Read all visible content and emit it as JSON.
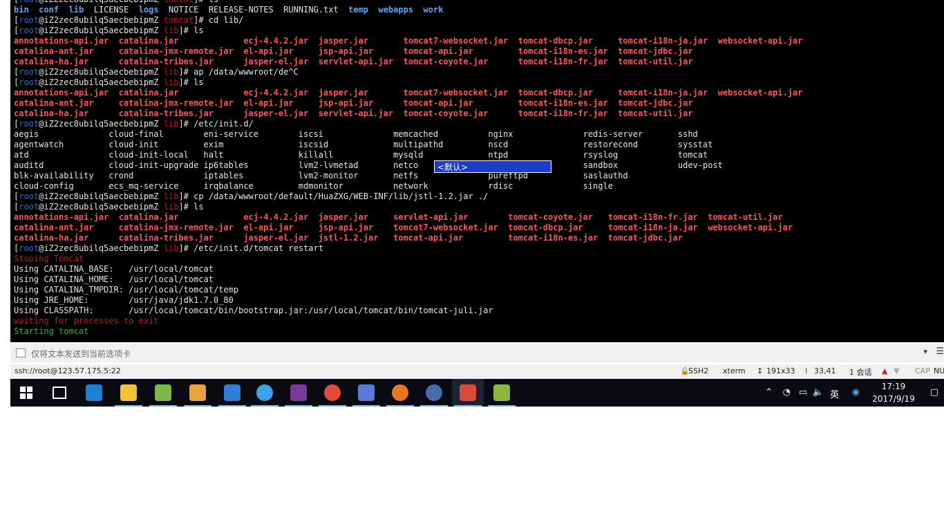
{
  "terminal": {
    "lines": [
      [
        {
          "t": "[",
          "c": ""
        },
        {
          "t": "root",
          "c": "host"
        },
        {
          "t": "@iZ2zec8ubilq5aecbebipmZ ",
          "c": ""
        },
        {
          "t": "tomcat",
          "c": "path"
        },
        {
          "t": "]# ls",
          "c": ""
        }
      ],
      [
        {
          "t": "bin",
          "c": "blue"
        },
        {
          "t": "  ",
          "c": ""
        },
        {
          "t": "conf",
          "c": "blue"
        },
        {
          "t": "  ",
          "c": ""
        },
        {
          "t": "lib",
          "c": "blue"
        },
        {
          "t": "  LICENSE  ",
          "c": ""
        },
        {
          "t": "logs",
          "c": "blue"
        },
        {
          "t": "  NOTICE  RELEASE-NOTES  RUNNING.txt  ",
          "c": ""
        },
        {
          "t": "temp",
          "c": "blue"
        },
        {
          "t": "  ",
          "c": ""
        },
        {
          "t": "webapps",
          "c": "blue"
        },
        {
          "t": "  ",
          "c": ""
        },
        {
          "t": "work",
          "c": "blue"
        }
      ],
      [
        {
          "t": "[",
          "c": ""
        },
        {
          "t": "root",
          "c": "host"
        },
        {
          "t": "@iZ2zec8ubilq5aecbebipmZ ",
          "c": ""
        },
        {
          "t": "tomcat",
          "c": "path"
        },
        {
          "t": "]# cd lib/",
          "c": ""
        }
      ],
      [
        {
          "t": "[",
          "c": ""
        },
        {
          "t": "root",
          "c": "host"
        },
        {
          "t": "@iZ2zec8ubilq5aecbebipmZ ",
          "c": ""
        },
        {
          "t": "lib",
          "c": "path"
        },
        {
          "t": "]# ls",
          "c": ""
        }
      ],
      [
        {
          "t": "annotations-api.jar  catalina.jar             ecj-4.4.2.jar  jasper.jar       tomcat7-websocket.jar  tomcat-dbcp.jar     tomcat-i18n-ja.jar  websocket-api.jar",
          "c": "red"
        }
      ],
      [
        {
          "t": "catalina-ant.jar     catalina-jmx-remote.jar  el-api.jar     jsp-api.jar      tomcat-api.jar         tomcat-i18n-es.jar  tomcat-jdbc.jar",
          "c": "red"
        }
      ],
      [
        {
          "t": "catalina-ha.jar      catalina-tribes.jar      jasper-el.jar  servlet-api.jar  tomcat-coyote.jar      tomcat-i18n-fr.jar  tomcat-util.jar",
          "c": "red"
        }
      ],
      [
        {
          "t": "[",
          "c": ""
        },
        {
          "t": "root",
          "c": "host"
        },
        {
          "t": "@iZ2zec8ubilq5aecbebipmZ ",
          "c": ""
        },
        {
          "t": "lib",
          "c": "path"
        },
        {
          "t": "]# ap /data/wwwroot/de^C",
          "c": ""
        }
      ],
      [
        {
          "t": "[",
          "c": ""
        },
        {
          "t": "root",
          "c": "host"
        },
        {
          "t": "@iZ2zec8ubilq5aecbebipmZ ",
          "c": ""
        },
        {
          "t": "lib",
          "c": "path"
        },
        {
          "t": "]# ls",
          "c": ""
        }
      ],
      [
        {
          "t": "annotations-api.jar  catalina.jar             ecj-4.4.2.jar  jasper.jar       tomcat7-websocket.jar  tomcat-dbcp.jar     tomcat-i18n-ja.jar  websocket-api.jar",
          "c": "red"
        }
      ],
      [
        {
          "t": "catalina-ant.jar     catalina-jmx-remote.jar  el-api.jar     jsp-api.jar      tomcat-api.jar         tomcat-i18n-es.jar  tomcat-jdbc.jar",
          "c": "red"
        }
      ],
      [
        {
          "t": "catalina-ha.jar      catalina-tribes.jar      jasper-el.jar  servlet-api.jar  tomcat-coyote.jar      tomcat-i18n-fr.jar  tomcat-util.jar",
          "c": "red"
        }
      ],
      [
        {
          "t": "[",
          "c": ""
        },
        {
          "t": "root",
          "c": "host"
        },
        {
          "t": "@iZ2zec8ubilq5aecbebipmZ ",
          "c": ""
        },
        {
          "t": "lib",
          "c": "path"
        },
        {
          "t": "]# /etc/init.d/",
          "c": ""
        }
      ],
      [
        {
          "t": "aegis              cloud-final        eni-service        iscsi              memcached          nginx              redis-server       sshd",
          "c": ""
        }
      ],
      [
        {
          "t": "agentwatch         cloud-init         exim               iscsid             multipathd         nscd               restorecond        sysstat",
          "c": ""
        }
      ],
      [
        {
          "t": "atd                cloud-init-local   halt               killall            mysqld             ntpd               rsyslog            tomcat",
          "c": ""
        }
      ],
      [
        {
          "t": "auditd             cloud-init-upgrade ip6tables          lvm2-lvmetad       netco                                 sandbox            udev-post",
          "c": ""
        }
      ],
      [
        {
          "t": "blk-availability   crond              iptables           lvm2-monitor       netfs              pureftpd           saslauthd",
          "c": ""
        }
      ],
      [
        {
          "t": "cloud-config       ecs_mq-service     irqbalance         mdmonitor          network            rdisc              single",
          "c": ""
        }
      ],
      [
        {
          "t": "[",
          "c": ""
        },
        {
          "t": "root",
          "c": "host"
        },
        {
          "t": "@iZ2zec8ubilq5aecbebipmZ ",
          "c": ""
        },
        {
          "t": "lib",
          "c": "path"
        },
        {
          "t": "]# cp /data/wwwroot/default/HuaZXG/WEB-INF/lib/jstl-1.2.jar ./",
          "c": ""
        }
      ],
      [
        {
          "t": "[",
          "c": ""
        },
        {
          "t": "root",
          "c": "host"
        },
        {
          "t": "@iZ2zec8ubilq5aecbebipmZ ",
          "c": ""
        },
        {
          "t": "lib",
          "c": "path"
        },
        {
          "t": "]# ls",
          "c": ""
        }
      ],
      [
        {
          "t": "annotations-api.jar  catalina.jar             ecj-4.4.2.jar  jasper.jar     servlet-api.jar        tomcat-coyote.jar   tomcat-i18n-fr.jar  tomcat-util.jar",
          "c": "red"
        }
      ],
      [
        {
          "t": "catalina-ant.jar     catalina-jmx-remote.jar  el-api.jar     jsp-api.jar    tomcat7-websocket.jar  tomcat-dbcp.jar     tomcat-i18n-ja.jar  websocket-api.jar",
          "c": "red"
        }
      ],
      [
        {
          "t": "catalina-ha.jar      catalina-tribes.jar      jasper-el.jar  jstl-1.2.jar   tomcat-api.jar         tomcat-i18n-es.jar  tomcat-jdbc.jar",
          "c": "red"
        }
      ],
      [
        {
          "t": "[",
          "c": ""
        },
        {
          "t": "root",
          "c": "host"
        },
        {
          "t": "@iZ2zec8ubilq5aecbebipmZ ",
          "c": ""
        },
        {
          "t": "lib",
          "c": "path"
        },
        {
          "t": "]# /etc/init.d/tomcat restart",
          "c": ""
        }
      ],
      [
        {
          "t": "Stoping Tomcat",
          "c": "dred"
        }
      ],
      [
        {
          "t": "Using CATALINA_BASE:   /usr/local/tomcat",
          "c": ""
        }
      ],
      [
        {
          "t": "Using CATALINA_HOME:   /usr/local/tomcat",
          "c": ""
        }
      ],
      [
        {
          "t": "Using CATALINA_TMPDIR: /usr/local/tomcat/temp",
          "c": ""
        }
      ],
      [
        {
          "t": "Using JRE_HOME:        /usr/java/jdk1.7.0_80",
          "c": ""
        }
      ],
      [
        {
          "t": "Using CLASSPATH:       /usr/local/tomcat/bin/bootstrap.jar:/usr/local/tomcat/bin/tomcat-juli.jar",
          "c": ""
        }
      ],
      [
        {
          "t": "waiting for processes to exit",
          "c": "dred"
        }
      ],
      [
        {
          "t": "Starting tomcat",
          "c": "green"
        }
      ]
    ]
  },
  "ime_popup": {
    "label": "<默认>"
  },
  "send_bar": {
    "text": "仅将文本发送到当前选项卡",
    "dropdown": "▾",
    "menu": "☰"
  },
  "status_bar": {
    "connection": "ssh://root@123.57.175.5:22",
    "protocol": "SSH2",
    "terminal_type": "xterm",
    "size": "191x33",
    "cursor": "33,41",
    "sessions": "1 会话",
    "caps": "CAP",
    "num": "NU"
  },
  "taskbar": {
    "apps": [
      {
        "name": "task-view",
        "color": "#ffffff"
      },
      {
        "name": "edge",
        "color": "#1e7fd6"
      },
      {
        "name": "file-explorer",
        "color": "#f3c13a"
      },
      {
        "name": "notepad",
        "color": "#7bb84a"
      },
      {
        "name": "paint",
        "color": "#e8a33c"
      },
      {
        "name": "network-app",
        "color": "#2f7fd8"
      },
      {
        "name": "ie",
        "color": "#3ba3e6"
      },
      {
        "name": "game-app",
        "color": "#7a3a9a"
      },
      {
        "name": "chrome",
        "color": "#e24a3a"
      },
      {
        "name": "dolphin-app",
        "color": "#5a7ad8"
      },
      {
        "name": "firefox",
        "color": "#e8761e"
      },
      {
        "name": "globe-app",
        "color": "#4a6aa8"
      },
      {
        "name": "xshell",
        "color": "#d84a3a"
      },
      {
        "name": "green-app",
        "color": "#8ab83a"
      }
    ],
    "tray": {
      "ime": "英",
      "time": "17:19",
      "date": "2017/9/19"
    }
  }
}
